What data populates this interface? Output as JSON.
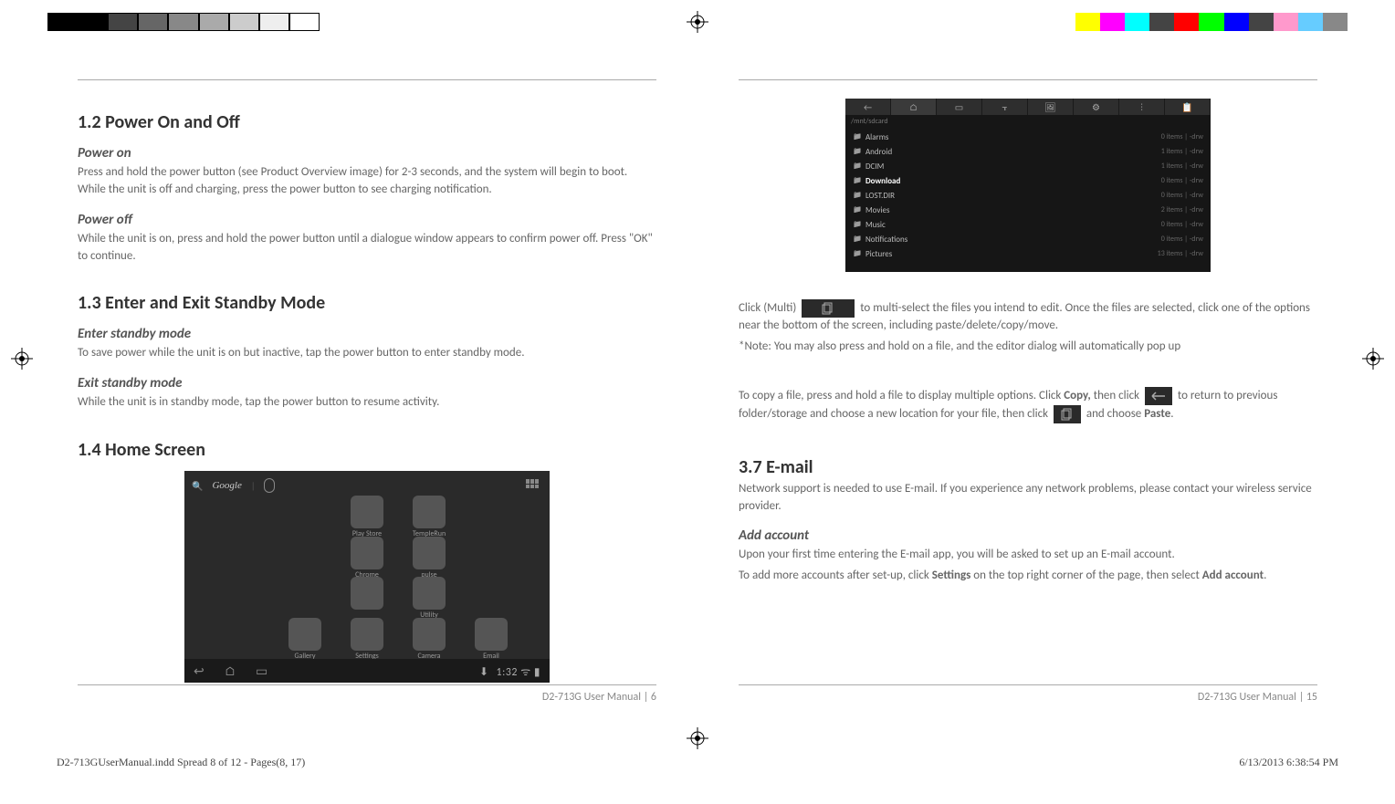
{
  "print": {
    "file_spread": "D2-713GUserManual.indd   Spread 8 of 12 - Pages(8, 17)",
    "timestamp": "6/13/2013   6:38:54 PM"
  },
  "left": {
    "sections": {
      "s12": {
        "title": "1.2 Power On and Off",
        "power_on_h": "Power on",
        "power_on_body": "Press and hold the power button (see Product Overview image) for 2-3 seconds, and the system will begin to boot. While the unit is off and charging, press the power button to see charging notification.",
        "power_off_h": "Power off",
        "power_off_body": "While the unit is on, press and hold the power button until a dialogue window appears to confirm power off. Press \"OK\" to continue."
      },
      "s13": {
        "title": "1.3 Enter and Exit Standby Mode",
        "enter_h": "Enter standby mode",
        "enter_body": "To save power while the unit is on but inactive, tap the power button to enter standby mode.",
        "exit_h": "Exit standby mode",
        "exit_body": "While the unit is in standby mode, tap the power button to resume activity."
      },
      "s14": {
        "title": "1.4 Home Screen"
      }
    },
    "homescreen": {
      "search_label": "Google",
      "icons": [
        {
          "label": "Play Store"
        },
        {
          "label": "TempleRun"
        },
        {
          "label": "Chrome"
        },
        {
          "label": "pulse"
        },
        {
          "label": ""
        },
        {
          "label": "Utility"
        },
        {
          "label": "Gallery"
        },
        {
          "label": "Settings"
        },
        {
          "label": "Camera"
        },
        {
          "label": "Email"
        }
      ],
      "time": "1:32"
    },
    "footer": "D2-713G User Manual  |  6"
  },
  "right": {
    "filemanager": {
      "path": "/mnt/sdcard",
      "rows": [
        {
          "name": "Alarms",
          "meta": "0 items | -drw"
        },
        {
          "name": "Android",
          "meta": "1 items | -drw"
        },
        {
          "name": "DCIM",
          "meta": "1 items | -drw"
        },
        {
          "name": "Download",
          "meta": "0 items | -drw",
          "hl": true
        },
        {
          "name": "LOST.DIR",
          "meta": "0 items | -drw"
        },
        {
          "name": "Movies",
          "meta": "2 items | -drw"
        },
        {
          "name": "Music",
          "meta": "0 items | -drw"
        },
        {
          "name": "Notifications",
          "meta": "0 items | -drw"
        },
        {
          "name": "Pictures",
          "meta": "13 items | -drw"
        }
      ]
    },
    "multi": {
      "pre": "Click (Multi) ",
      "post1": " to multi-select the files you intend to edit. Once the files are selected, click one of the options near the bottom of the screen",
      "post2": ", including paste/delete/copy/move.",
      "note": "*Note: You may also press and hold on a file, and the editor dialog will automatically pop up"
    },
    "copy": {
      "line1a": "To copy a file, press and hold a file to display multiple options. Click ",
      "copy_word": "Copy,",
      "line1b": " then click ",
      "line1c": " to return to previous folder/storage and choose a new location for your file, then click ",
      "line1d": " and choose ",
      "paste_word": "Paste",
      "period": "."
    },
    "email": {
      "title": "3.7 E-mail",
      "intro": "Network support is needed to use E-mail. If you experience any network problems, please contact your wireless service provider.",
      "add_h": "Add account",
      "add_body1": "Upon your first time entering the E-mail app, you will be asked to set up an E-mail account.",
      "add_body2a": "To add more accounts after set-up, click ",
      "settings_word": "Settings",
      "add_body2b": " on the top right corner of the page, then select ",
      "addacct_word": "Add account",
      "add_body2c": "."
    },
    "footer": "D2-713G User Manual  |  15"
  },
  "colors": {
    "left_bar": [
      "#000",
      "#000",
      "#444",
      "#666",
      "#888",
      "#aaa",
      "#ccc",
      "#eee",
      "#fff"
    ],
    "right_bar": [
      "#ffff00",
      "#ff00ff",
      "#00ffff",
      "#444",
      "#ff0000",
      "#00ff00",
      "#0000ff",
      "#444",
      "#ff99cc",
      "#66ccff",
      "#888"
    ]
  }
}
